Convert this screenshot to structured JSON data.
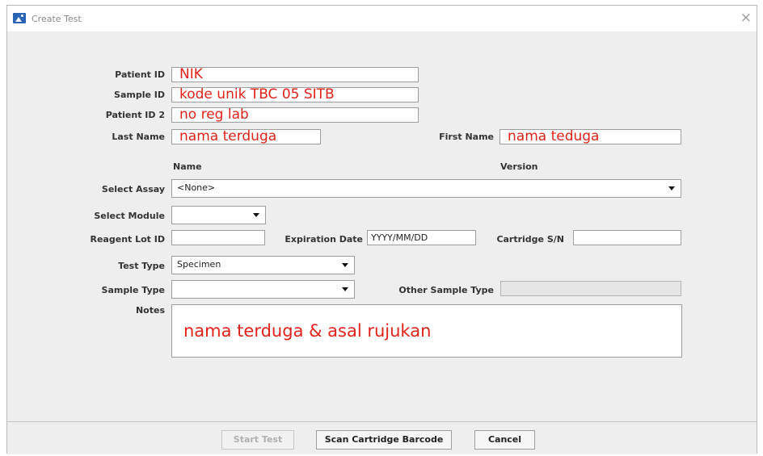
{
  "window": {
    "title": "Create Test",
    "close_glyph": "×"
  },
  "form": {
    "patient_id": {
      "label": "Patient ID",
      "value": "NIK"
    },
    "sample_id": {
      "label": "Sample ID",
      "value": "kode unik TBC 05 SITB"
    },
    "patient_id2": {
      "label": "Patient ID 2",
      "value": "no reg lab"
    },
    "last_name": {
      "label": "Last Name",
      "value": "nama terduga"
    },
    "first_name": {
      "label": "First Name",
      "value": "nama teduga"
    },
    "columns": {
      "name": "Name",
      "version": "Version"
    },
    "select_assay": {
      "label": "Select Assay",
      "value": "<None>"
    },
    "select_module": {
      "label": "Select Module",
      "value": ""
    },
    "reagent_lot_id": {
      "label": "Reagent Lot ID",
      "value": ""
    },
    "expiration_date": {
      "label": "Expiration Date",
      "value": "YYYY/MM/DD"
    },
    "cartridge_sn": {
      "label": "Cartridge S/N",
      "value": ""
    },
    "test_type": {
      "label": "Test Type",
      "value": "Specimen"
    },
    "sample_type": {
      "label": "Sample Type",
      "value": ""
    },
    "other_sample_type": {
      "label": "Other Sample Type",
      "value": ""
    },
    "notes": {
      "label": "Notes",
      "value": "nama terduga & asal rujukan"
    }
  },
  "buttons": {
    "start_test": "Start Test",
    "scan_barcode": "Scan Cartridge Barcode",
    "cancel": "Cancel"
  },
  "colors": {
    "annotation": "#e2231a",
    "panel": "#eeeeee"
  }
}
